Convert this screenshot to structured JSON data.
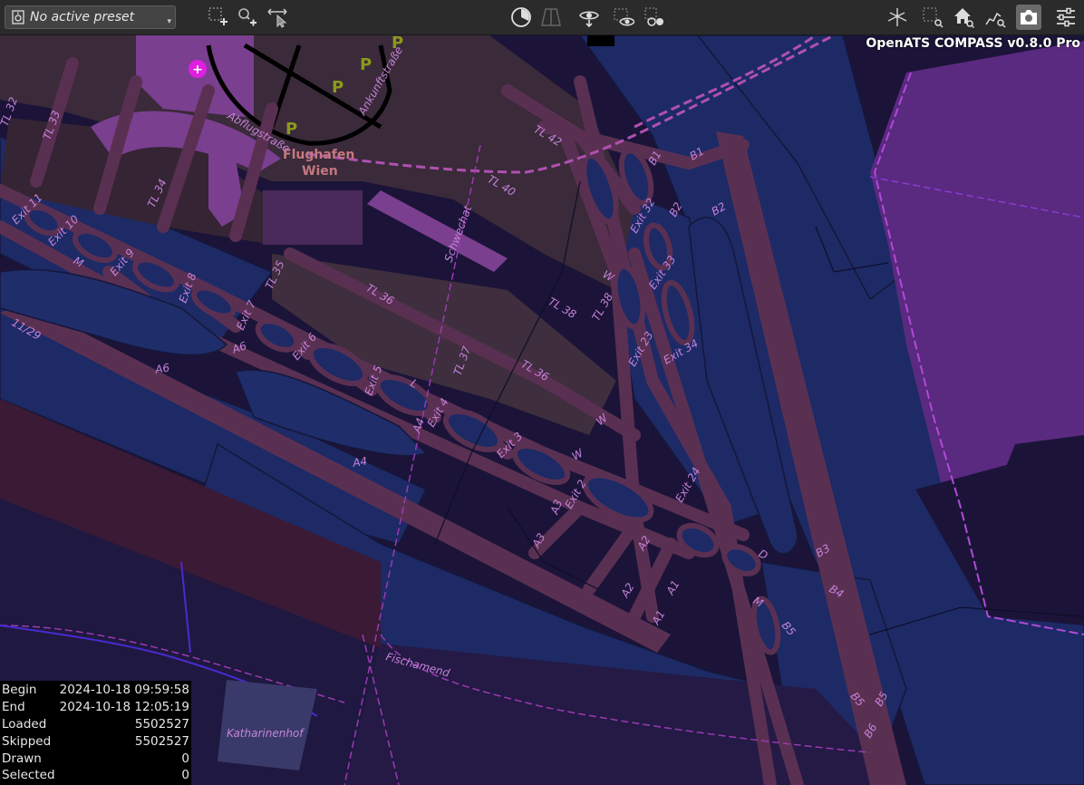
{
  "toolbar": {
    "preset_text": "No active preset",
    "icons": [
      "select-rectangle-icon",
      "zoom-select-icon",
      "pan-measure-icon",
      "timeline-icon",
      "filter-icon",
      "view-icon",
      "view-show-icon",
      "view-compare-icon",
      "3d-view-icon",
      "zoom-rect-icon",
      "home-icon",
      "zoom-data-icon",
      "screenshot-icon",
      "settings-icon"
    ]
  },
  "app_title": "OpenATS COMPASS v0.8.0 Pro",
  "map_labels": {
    "airport": "Flughafen",
    "city": "Wien",
    "abflug": "Abflugstraße",
    "ankunft": "Ankunftstraße",
    "schwechat": "Schwechat",
    "fischamend": "Fischamend",
    "katharinenhof": "Katharinenhof",
    "runway": "11/29",
    "tl32": "TL 32",
    "tl33": "TL 33",
    "tl34": "TL 34",
    "tl35": "TL 35",
    "tl36a": "TL 36",
    "tl36b": "TL 36",
    "tl37": "TL 37",
    "tl38": "TL 38",
    "tl38b": "TL 38",
    "tl40": "TL 40",
    "tl42": "TL 42",
    "exit11": "Exit 11",
    "exit10": "Exit 10",
    "exit9": "Exit 9",
    "exit8": "Exit 8",
    "exit7": "Exit 7",
    "exit6": "Exit 6",
    "exit5": "Exit 5",
    "exit4": "Exit 4",
    "exit3": "Exit 3",
    "exit2": "Exit 2",
    "exit32": "Exit 32",
    "exit33": "Exit 33",
    "exit23": "Exit 23",
    "exit34": "Exit 34",
    "exit24": "Exit 24",
    "m1": "M",
    "m2": "M",
    "a6a": "A6",
    "a6b": "A6",
    "a4a": "A4",
    "a4b": "A4",
    "a3a": "A3",
    "a3b": "A3",
    "a2a": "A2",
    "a2b": "A2",
    "a1a": "A1",
    "a1b": "A1",
    "b1a": "B1",
    "b1b": "B1",
    "b2a": "B2",
    "b2b": "B2",
    "b3": "B3",
    "b4": "B4",
    "b5a": "B5",
    "b5b": "B5",
    "b5c": "B5",
    "b6": "B6",
    "w1": "W",
    "w2": "W",
    "w3": "W",
    "l": "L",
    "d": "D",
    "p": "P"
  },
  "stats": {
    "begin_label": "Begin",
    "begin_value": "2024-10-18 09:59:58",
    "end_label": "End",
    "end_value": "2024-10-18 12:05:19",
    "loaded_label": "Loaded",
    "loaded_value": "5502527",
    "skipped_label": "Skipped",
    "skipped_value": "5502527",
    "drawn_label": "Drawn",
    "drawn_value": "0",
    "selected_label": "Selected",
    "selected_value": "0"
  },
  "colors": {
    "toolbar_bg": "#2b2b2b",
    "map_water": "#1d2a66",
    "map_dark": "#1b1438",
    "taxiway": "#5a3052",
    "apron": "#3a2a3a",
    "terminal": "#7a3f8f",
    "region": "#5a2980",
    "label": "#c582d8"
  }
}
